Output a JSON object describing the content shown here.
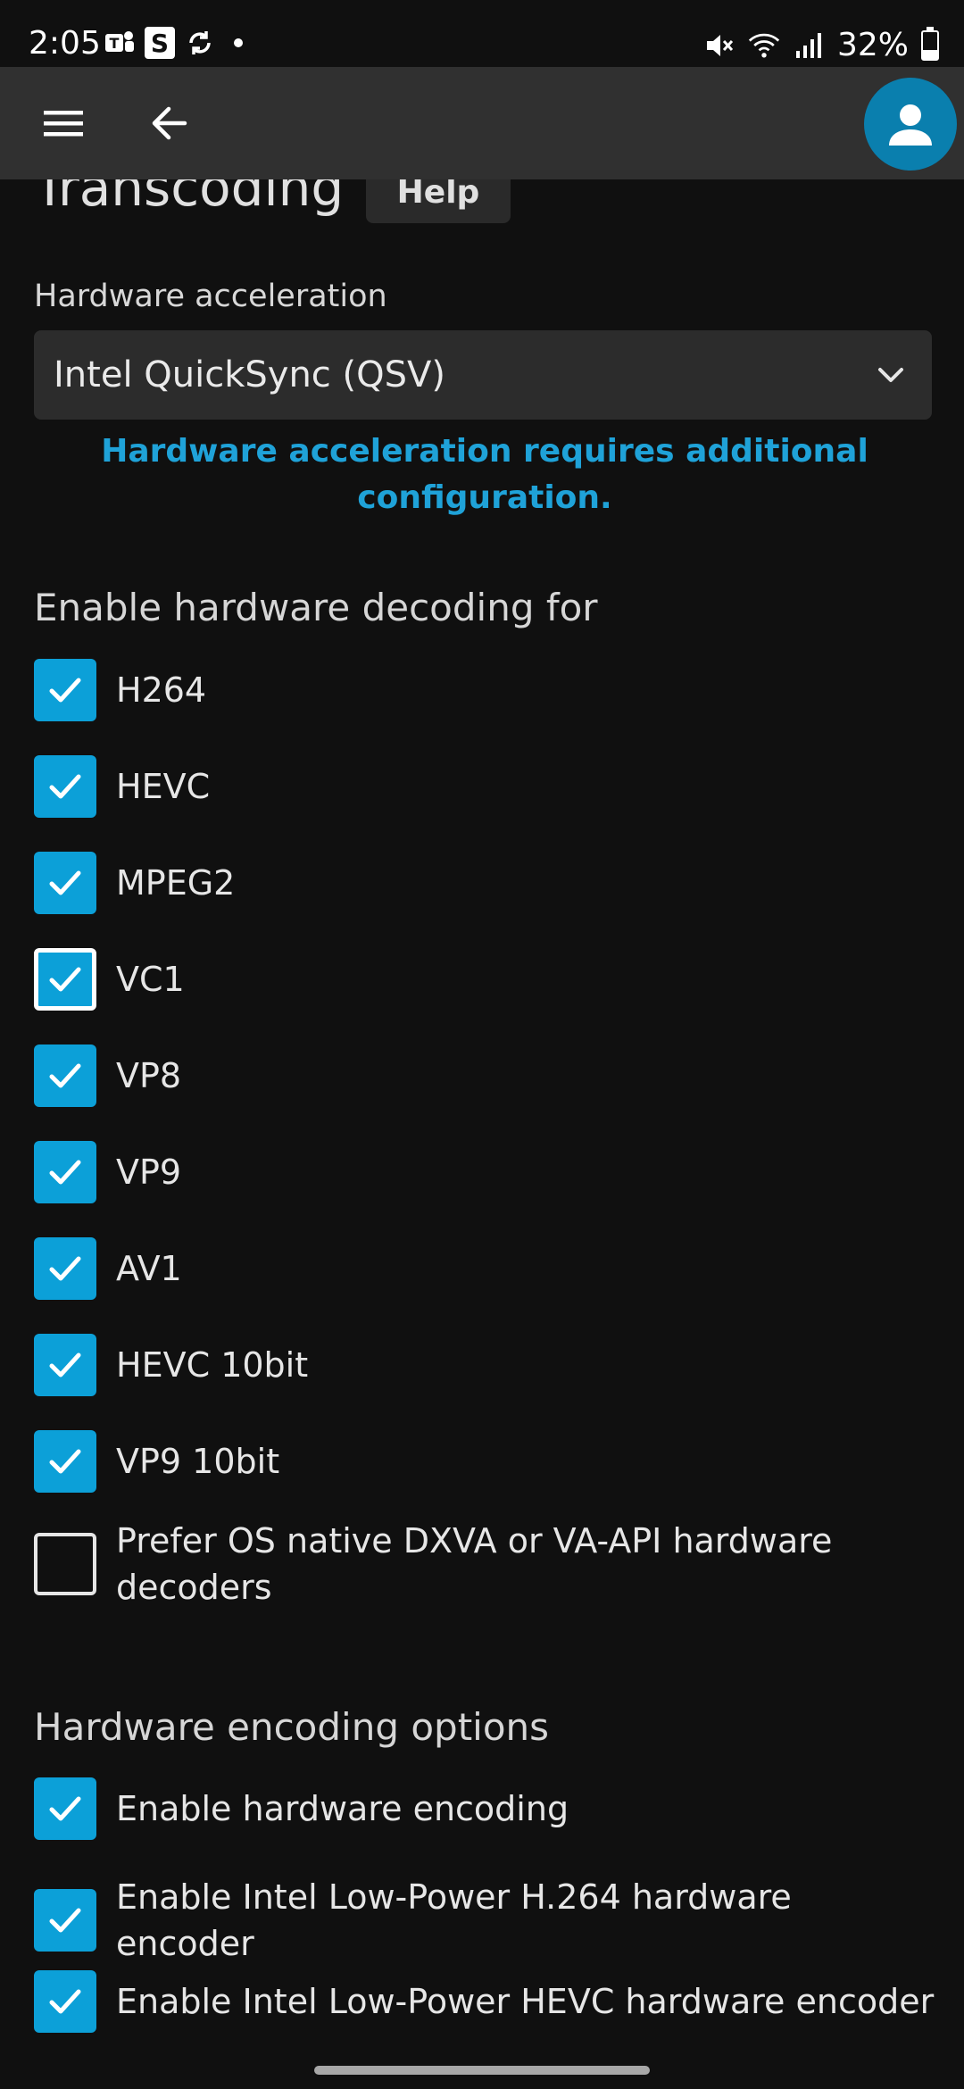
{
  "status_bar": {
    "time": "2:05",
    "s_glyph": "S",
    "battery": "32%",
    "battery_level": 0.32
  },
  "header": {
    "menu_icon": "hamburger-menu-icon",
    "back_icon": "arrow-back-icon",
    "avatar_icon": "user-avatar-icon"
  },
  "page": {
    "title": "Transcoding",
    "help_label": "Help"
  },
  "hardware_acceleration": {
    "label": "Hardware acceleration",
    "selected": "Intel QuickSync (QSV)",
    "note": "Hardware acceleration requires additional configuration."
  },
  "decoding": {
    "heading": "Enable hardware decoding for",
    "codecs": [
      {
        "label": "H264",
        "checked": true
      },
      {
        "label": "HEVC",
        "checked": true
      },
      {
        "label": "MPEG2",
        "checked": true
      },
      {
        "label": "VC1",
        "checked": true,
        "focused": true
      },
      {
        "label": "VP8",
        "checked": true
      },
      {
        "label": "VP9",
        "checked": true
      },
      {
        "label": "AV1",
        "checked": true
      },
      {
        "label": "HEVC 10bit",
        "checked": true
      },
      {
        "label": "VP9 10bit",
        "checked": true
      }
    ],
    "prefer_native": {
      "label": "Prefer OS native DXVA or VA-API hardware decoders",
      "checked": false
    }
  },
  "encoding": {
    "heading": "Hardware encoding options",
    "options": [
      {
        "label": "Enable hardware encoding",
        "checked": true
      },
      {
        "label": "Enable Intel Low-Power H.264 hardware encoder",
        "checked": true
      },
      {
        "label": "Enable Intel Low-Power HEVC hardware encoder",
        "checked": true
      }
    ]
  },
  "colors": {
    "accent": "#0ca0d8",
    "link": "#1fa2d8",
    "header_bg": "#303030",
    "page_bg": "#101010"
  }
}
